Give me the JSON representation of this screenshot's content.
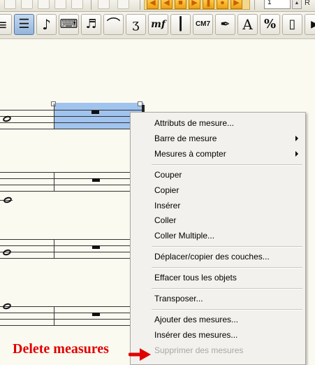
{
  "playback": {
    "measure_number": "1",
    "trailing_label": "R"
  },
  "toolbar": {
    "tools": [
      {
        "name": "staff-tool",
        "glyph": "≡"
      },
      {
        "name": "selection-tool",
        "glyph": "☰"
      },
      {
        "name": "simple-entry-tool",
        "glyph": "♪"
      },
      {
        "name": "speedy-entry-tool",
        "glyph": "⌨"
      },
      {
        "name": "hyperscribe-tool",
        "glyph": "♬"
      },
      {
        "name": "smart-shape-tool",
        "glyph": "⌒"
      },
      {
        "name": "articulation-tool",
        "glyph": "ʒ"
      },
      {
        "name": "expression-tool",
        "glyph": "mf"
      },
      {
        "name": "repeat-tool",
        "glyph": "┃"
      },
      {
        "name": "chord-tool",
        "glyph": "CM7"
      },
      {
        "name": "lyrics-tool",
        "glyph": "✒"
      },
      {
        "name": "text-tool",
        "glyph": "A"
      },
      {
        "name": "resize-tool",
        "glyph": "%"
      },
      {
        "name": "page-layout-tool",
        "glyph": "▯"
      }
    ]
  },
  "context_menu": {
    "items": [
      {
        "label": "Attributs de mesure...",
        "submenu": false,
        "enabled": true
      },
      {
        "label": "Barre de mesure",
        "submenu": true,
        "enabled": true
      },
      {
        "label": "Mesures à compter",
        "submenu": true,
        "enabled": true
      },
      {
        "label": "Couper",
        "submenu": false,
        "enabled": true
      },
      {
        "label": "Copier",
        "submenu": false,
        "enabled": true
      },
      {
        "label": "Insérer",
        "submenu": false,
        "enabled": true
      },
      {
        "label": "Coller",
        "submenu": false,
        "enabled": true
      },
      {
        "label": "Coller Multiple...",
        "submenu": false,
        "enabled": true
      },
      {
        "label": "Déplacer/copier des couches...",
        "submenu": false,
        "enabled": true
      },
      {
        "label": "Effacer tous les objets",
        "submenu": false,
        "enabled": true
      },
      {
        "label": "Transposer...",
        "submenu": false,
        "enabled": true
      },
      {
        "label": "Ajouter des mesures...",
        "submenu": false,
        "enabled": true
      },
      {
        "label": "Insérer des mesures...",
        "submenu": false,
        "enabled": true
      },
      {
        "label": "Supprimer des mesures",
        "submenu": false,
        "enabled": false
      }
    ]
  },
  "annotation": {
    "text": "Delete measures",
    "color": "#e10000"
  },
  "colors": {
    "selection": "#9cc1ee",
    "page": "#fbfaf1",
    "menu": "#f2f1ed"
  }
}
